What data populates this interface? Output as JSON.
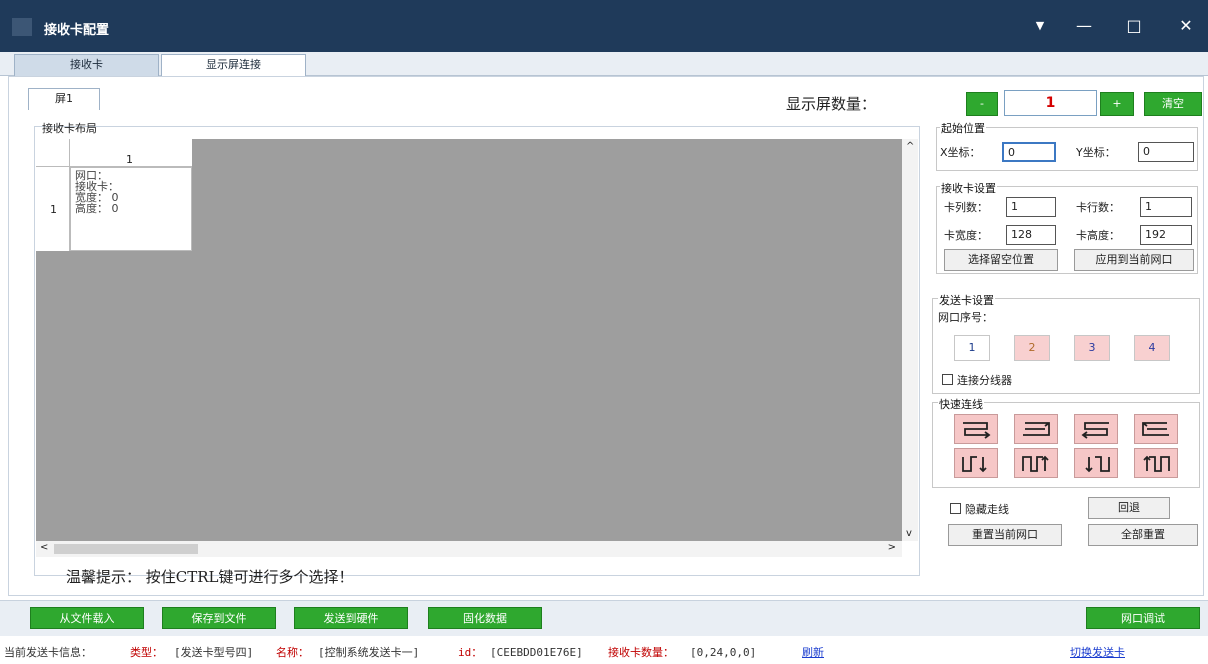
{
  "window": {
    "title": "接收卡配置",
    "controls": {
      "dropdown": "▼",
      "minimize": "—",
      "maximize": "□",
      "close": "✕"
    }
  },
  "tabs": [
    {
      "label": "接收卡"
    },
    {
      "label": "显示屏连接"
    }
  ],
  "screen_tab": {
    "label": "屏1"
  },
  "screen_count": {
    "label": "显示屏数量：",
    "minus": "-",
    "value": "1",
    "plus": "+",
    "clear": "清空"
  },
  "layout": {
    "group_label": "接收卡布局",
    "col_header": "1",
    "row_header": "1",
    "cell": {
      "port_label": "网口：",
      "card_label": "接收卡：",
      "width_label": "宽度：",
      "width_value": "0",
      "height_label": "高度：",
      "height_value": "0"
    },
    "scroll": {
      "up": "^",
      "down": "v",
      "left": "<",
      "right": ">"
    }
  },
  "tip": "温馨提示：  按住CTRL键可进行多个选择！",
  "start_position": {
    "group_label": "起始位置",
    "x_label": "X坐标：",
    "x_value": "0",
    "y_label": "Y坐标：",
    "y_value": "0"
  },
  "receiver_settings": {
    "group_label": "接收卡设置",
    "cols_label": "卡列数：",
    "cols_value": "1",
    "rows_label": "卡行数：",
    "rows_value": "1",
    "width_label": "卡宽度：",
    "width_value": "128",
    "height_label": "卡高度：",
    "height_value": "192",
    "select_blank_button": "选择留空位置",
    "apply_button": "应用到当前网口"
  },
  "sender_settings": {
    "group_label": "发送卡设置",
    "port_order_label": "网口序号：",
    "ports": [
      {
        "label": "1",
        "bg": "#ffffff",
        "color": "#1a3a8a"
      },
      {
        "label": "2",
        "bg": "#f8d0d0",
        "color": "#b06b2a"
      },
      {
        "label": "3",
        "bg": "#f8d0d0",
        "color": "#2a3aa0"
      },
      {
        "label": "4",
        "bg": "#f8d0d0",
        "color": "#2a3aa0"
      }
    ],
    "splitter_label": "连接分线器"
  },
  "quick_wiring": {
    "group_label": "快速连线",
    "buttons": [
      "snake-right-down",
      "snake-right-up",
      "snake-left-down",
      "snake-left-up",
      "snake-down-right",
      "snake-up-right",
      "snake-down-left",
      "snake-up-left"
    ]
  },
  "actions": {
    "hide_traces_label": "隐藏走线",
    "undo_button": "回退",
    "reset_port_button": "重置当前网口",
    "reset_all_button": "全部重置"
  },
  "bottom_buttons": {
    "load_file": "从文件载入",
    "save_file": "保存到文件",
    "send_hardware": "发送到硬件",
    "solidify": "固化数据",
    "port_debug": "网口调试"
  },
  "status": {
    "prefix": "当前发送卡信息：",
    "type_label": "类型：",
    "type_value": "[发送卡型号四]",
    "name_label": "名称：",
    "name_value": "[控制系统发送卡一]",
    "id_label": "id：",
    "id_value": "[CEEBDD01E76E]",
    "count_label": "接收卡数量：",
    "count_value": "[0,24,0,0]",
    "refresh_link": "刷新",
    "switch_link": "切换发送卡"
  },
  "colors": {
    "title_bar": "#1f3a5a",
    "grid": "#9e9e9e",
    "green_button": "#2fa82f",
    "wire_button": "#f6c7c7"
  }
}
